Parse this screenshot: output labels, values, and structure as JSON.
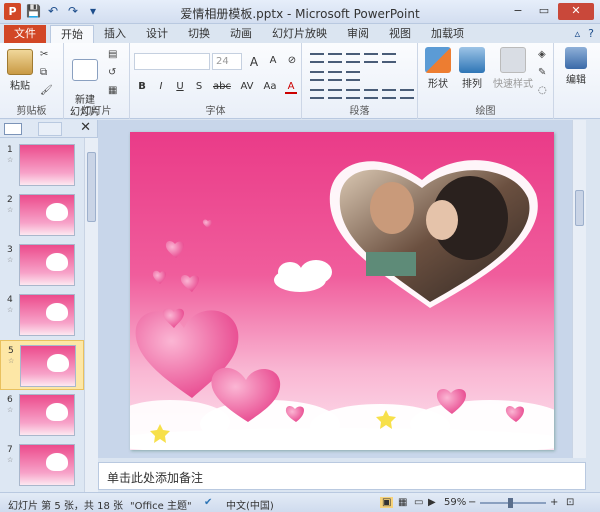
{
  "window": {
    "title": "爱情相册模板.pptx - Microsoft PowerPoint",
    "app_letter": "P",
    "controls": [
      "−",
      "▭",
      "✕"
    ]
  },
  "qat": {
    "save": "💾",
    "undo": "↶",
    "redo": "↷",
    "more": "▾"
  },
  "tabs": [
    "文件",
    "开始",
    "插入",
    "设计",
    "切换",
    "动画",
    "幻灯片放映",
    "审阅",
    "视图",
    "加载项"
  ],
  "active_tab": "开始",
  "tabs_right": {
    "minimize": "▵",
    "help": "?"
  },
  "ribbon": {
    "clipboard": {
      "label": "剪贴板",
      "paste": "粘贴"
    },
    "slides": {
      "label": "幻灯片",
      "new_slide": "新建\n幻灯片"
    },
    "font": {
      "label": "字体",
      "font_name": "",
      "font_size": "24",
      "format_row1": [
        "A",
        "A",
        "⊘"
      ],
      "format_row2": [
        "B",
        "I",
        "U",
        "S",
        "abc",
        "AV",
        "Aa",
        "A"
      ]
    },
    "paragraph": {
      "label": "段落"
    },
    "drawing": {
      "label": "绘图",
      "shape": "形状",
      "arrange": "排列",
      "quick_styles": "快速样式"
    },
    "editing": {
      "label": "编辑",
      "edit": "编辑"
    }
  },
  "slide_panel": {
    "close": "✕",
    "slides": [
      {
        "num": "1",
        "star": "☆"
      },
      {
        "num": "2",
        "star": "☆"
      },
      {
        "num": "3",
        "star": "☆"
      },
      {
        "num": "4",
        "star": "☆"
      },
      {
        "num": "5",
        "star": "☆"
      },
      {
        "num": "6",
        "star": "☆"
      },
      {
        "num": "7",
        "star": "☆"
      }
    ],
    "selected": "5"
  },
  "notes": {
    "placeholder": "单击此处添加备注"
  },
  "status": {
    "slide_info": "幻灯片 第 5 张，共 18 张",
    "theme": "\"Office 主题\"",
    "language": "中文(中国)",
    "zoom": "59%",
    "zoom_out": "−",
    "zoom_in": "+",
    "zoom_fraction": 0.45
  },
  "colors": {
    "accent": "#d24726",
    "slide_pink": "#ea3b88",
    "heart": "#f36aa5"
  }
}
